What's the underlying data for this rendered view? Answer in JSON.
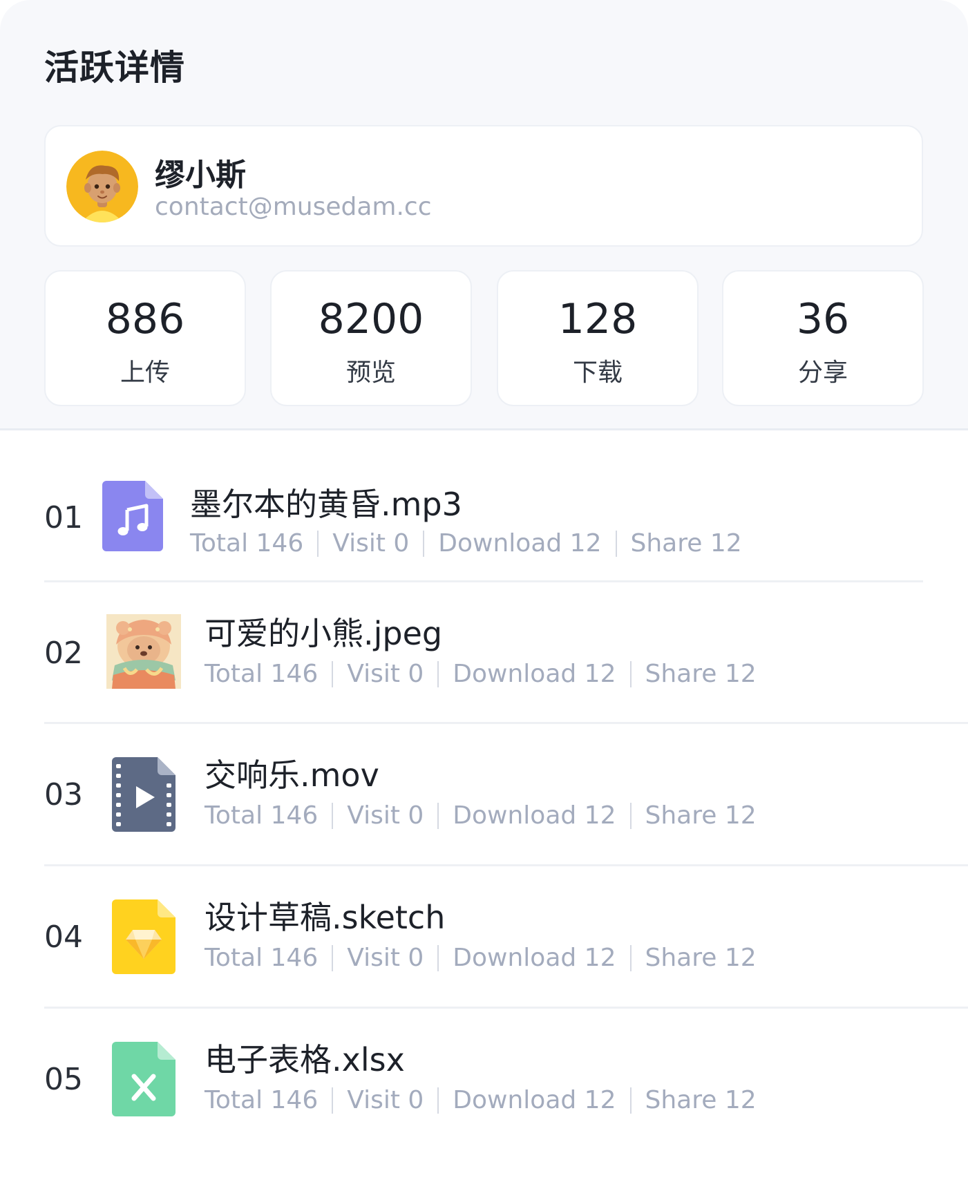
{
  "title": "活跃详情",
  "user": {
    "name": "缪小斯",
    "email": "contact@musedam.cc",
    "avatar_icon": "person-avatar-icon"
  },
  "stats": [
    {
      "value": "886",
      "label": "上传"
    },
    {
      "value": "8200",
      "label": "预览"
    },
    {
      "value": "128",
      "label": "下载"
    },
    {
      "value": "36",
      "label": "分享"
    }
  ],
  "files": [
    {
      "index": "01",
      "name": "墨尔本的黄昏.mp3",
      "icon": "music-file-icon",
      "total": "Total 146",
      "visit": "Visit 0",
      "download": "Download 12",
      "share": "Share 12"
    },
    {
      "index": "02",
      "name": "可爱的小熊.jpeg",
      "icon": "bear-thumbnail-image",
      "total": "Total 146",
      "visit": "Visit 0",
      "download": "Download 12",
      "share": "Share 12"
    },
    {
      "index": "03",
      "name": "交响乐.mov",
      "icon": "video-file-icon",
      "total": "Total 146",
      "visit": "Visit 0",
      "download": "Download 12",
      "share": "Share 12"
    },
    {
      "index": "04",
      "name": "设计草稿.sketch",
      "icon": "sketch-file-icon",
      "total": "Total 146",
      "visit": "Visit 0",
      "download": "Download 12",
      "share": "Share 12"
    },
    {
      "index": "05",
      "name": "电子表格.xlsx",
      "icon": "excel-file-icon",
      "total": "Total 146",
      "visit": "Visit 0",
      "download": "Download 12",
      "share": "Share 12"
    }
  ],
  "colors": {
    "music": "#8a86ef",
    "video": "#5d6a85",
    "sketch": "#ffd21f",
    "excel": "#6fd7a6"
  }
}
